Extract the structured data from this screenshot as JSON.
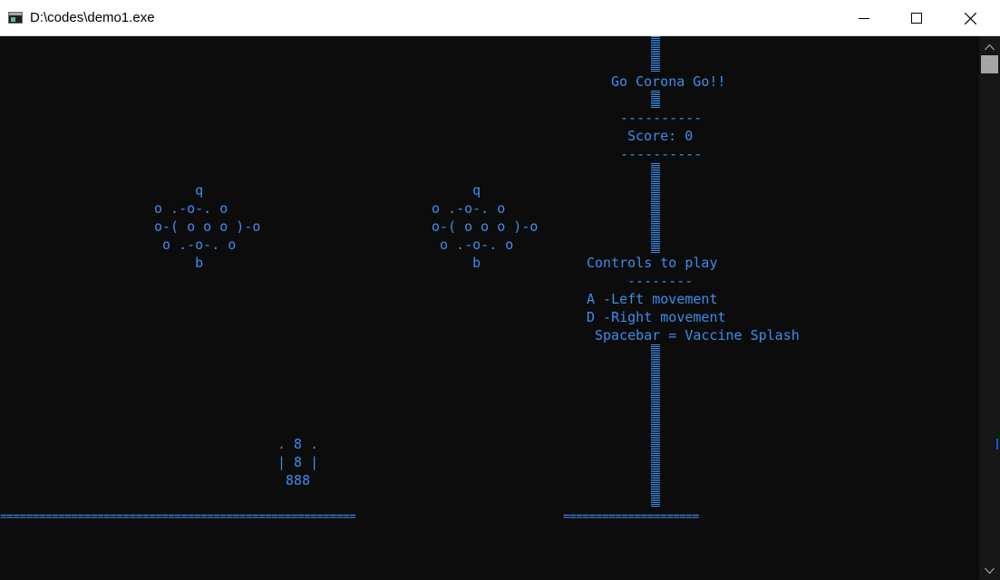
{
  "window": {
    "title": "D:\\codes\\demo1.exe"
  },
  "game": {
    "title": "Go Corona Go!!",
    "score_divider_top": "----------",
    "score": "Score: 0",
    "score_divider_bottom": "----------",
    "virus_left": "     q\no .-o-. o\no-( o o o )-o\n o .-o-. o\n     b",
    "virus_right": "     q\no .-o-. o\no-( o o o )-o\n o .-o-. o\n     b",
    "player": ". 8 .\n| 8 |\n 888",
    "ground_left": "=======================================================",
    "ground_right": "=====================",
    "controls": {
      "heading": "Controls to play",
      "divider": "--------",
      "left": "A -Left movement",
      "right": "D -Right movement",
      "fire": "Spacebar = Vaccine Splash"
    }
  },
  "colors": {
    "console_bg": "#0c0c0c",
    "console_text": "#3b8eea",
    "titlebar_bg": "#ffffff"
  },
  "icons": [
    "console-app-icon",
    "minimize-icon",
    "maximize-icon",
    "close-icon",
    "scroll-up-icon",
    "scroll-down-icon"
  ]
}
